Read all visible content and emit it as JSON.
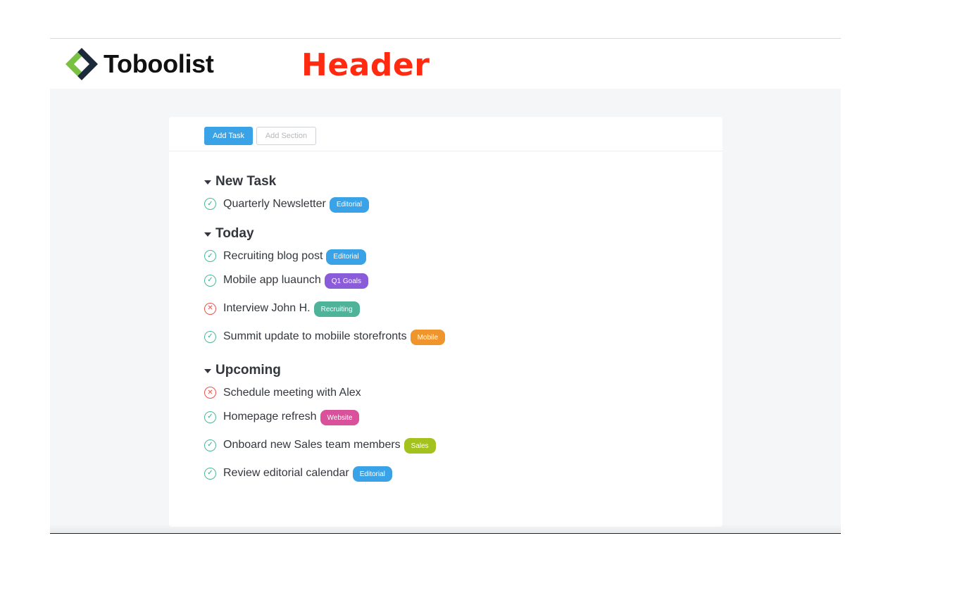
{
  "brand": {
    "name": "Toboolist",
    "logo_icon": "diamond-chevron-logo",
    "colors": {
      "green": "#7ac143",
      "dark": "#1c2a3a"
    }
  },
  "header": {
    "label": "Header",
    "color": "#ff2a10"
  },
  "toolbar": {
    "add_task_label": "Add Task",
    "add_section_label": "Add Section"
  },
  "sections": [
    {
      "title": "New Task",
      "tasks": [
        {
          "name": "Quarterly Newsletter",
          "status": "done",
          "tag": "Editorial",
          "tag_color": "#3aa3e8"
        }
      ]
    },
    {
      "title": "Today",
      "tasks": [
        {
          "name": "Recruiting blog post",
          "status": "done",
          "tag": "Editorial",
          "tag_color": "#3aa3e8"
        },
        {
          "name": "Mobile app luaunch",
          "status": "done",
          "tag": "Q1 Goals",
          "tag_color": "#8a5cd9"
        },
        {
          "name": "Interview John H.",
          "status": "fail",
          "tag": "Recruiting",
          "tag_color": "#4fb39a"
        },
        {
          "name": "Summit update to mobiile storefronts",
          "status": "done",
          "tag": "Mobile",
          "tag_color": "#f0952c"
        }
      ]
    },
    {
      "title": "Upcoming",
      "tasks": [
        {
          "name": "Schedule meeting with Alex",
          "status": "fail",
          "tag": "",
          "tag_color": ""
        },
        {
          "name": "Homepage refresh",
          "status": "done",
          "tag": "Website",
          "tag_color": "#d9519b"
        },
        {
          "name": "Onboard new Sales team members",
          "status": "done",
          "tag": "Sales",
          "tag_color": "#a4c21e"
        },
        {
          "name": "Review editorial calendar",
          "status": "done",
          "tag": "Editorial",
          "tag_color": "#3aa3e8"
        }
      ]
    }
  ],
  "icons": {
    "done": "check-circle-icon",
    "fail": "x-circle-icon",
    "caret": "caret-down-icon"
  }
}
